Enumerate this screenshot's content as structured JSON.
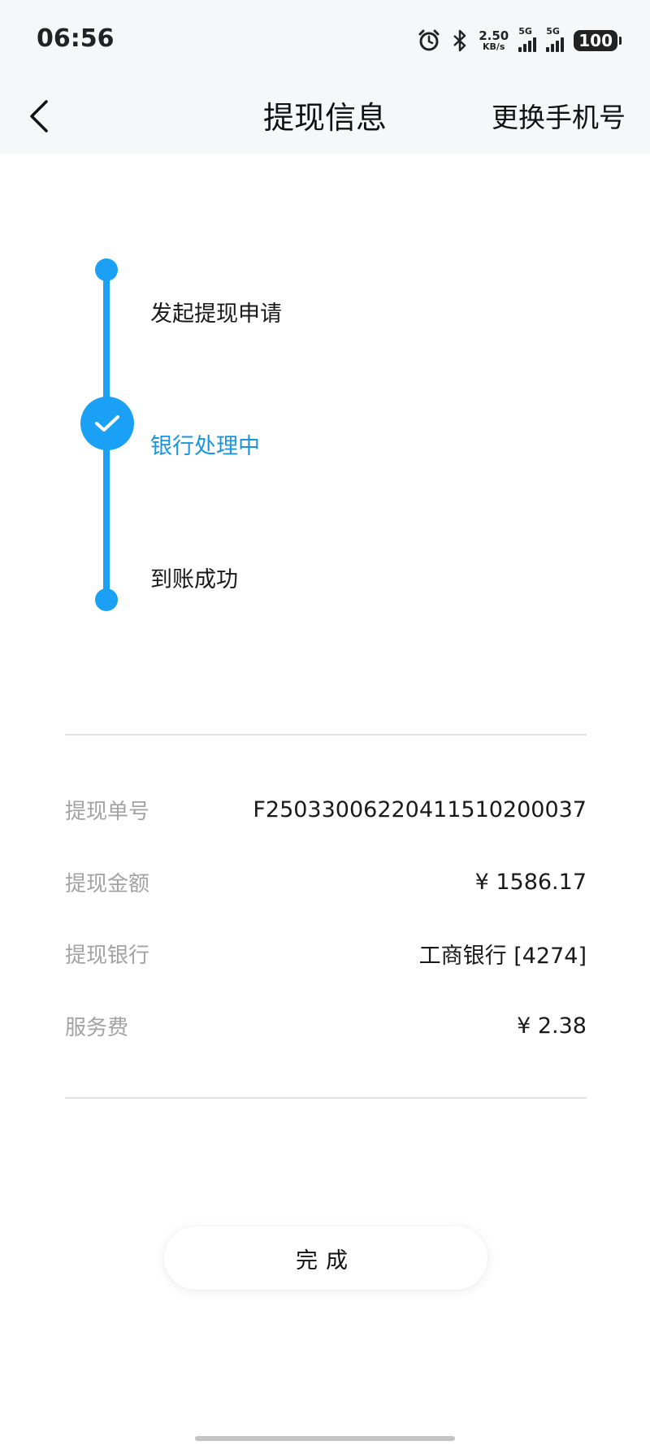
{
  "status_bar": {
    "time": "06:56",
    "net_speed_value": "2.50",
    "net_speed_unit": "KB/s",
    "sim1_label": "5G",
    "sim2_label": "5G",
    "battery": "100",
    "icons": [
      "alarm-icon",
      "bluetooth-icon",
      "signal-icon",
      "signal-icon",
      "battery-icon"
    ]
  },
  "header": {
    "title": "提现信息",
    "action": "更换手机号"
  },
  "progress": {
    "steps": [
      {
        "label": "发起提现申请",
        "state": "done"
      },
      {
        "label": "银行处理中",
        "state": "current"
      },
      {
        "label": "到账成功",
        "state": "pending"
      }
    ],
    "accent_color": "#1aa0f5",
    "current_label_color": "#1a96e0"
  },
  "details": {
    "rows": [
      {
        "label": "提现单号",
        "value": "F250330062204115102000​37"
      },
      {
        "label": "提现金额",
        "value": "¥ 1586.17"
      },
      {
        "label": "提现银行",
        "value": "工商银行 [4274]"
      },
      {
        "label": "服务费",
        "value": "¥ 2.38"
      }
    ]
  },
  "done_button": "完成"
}
